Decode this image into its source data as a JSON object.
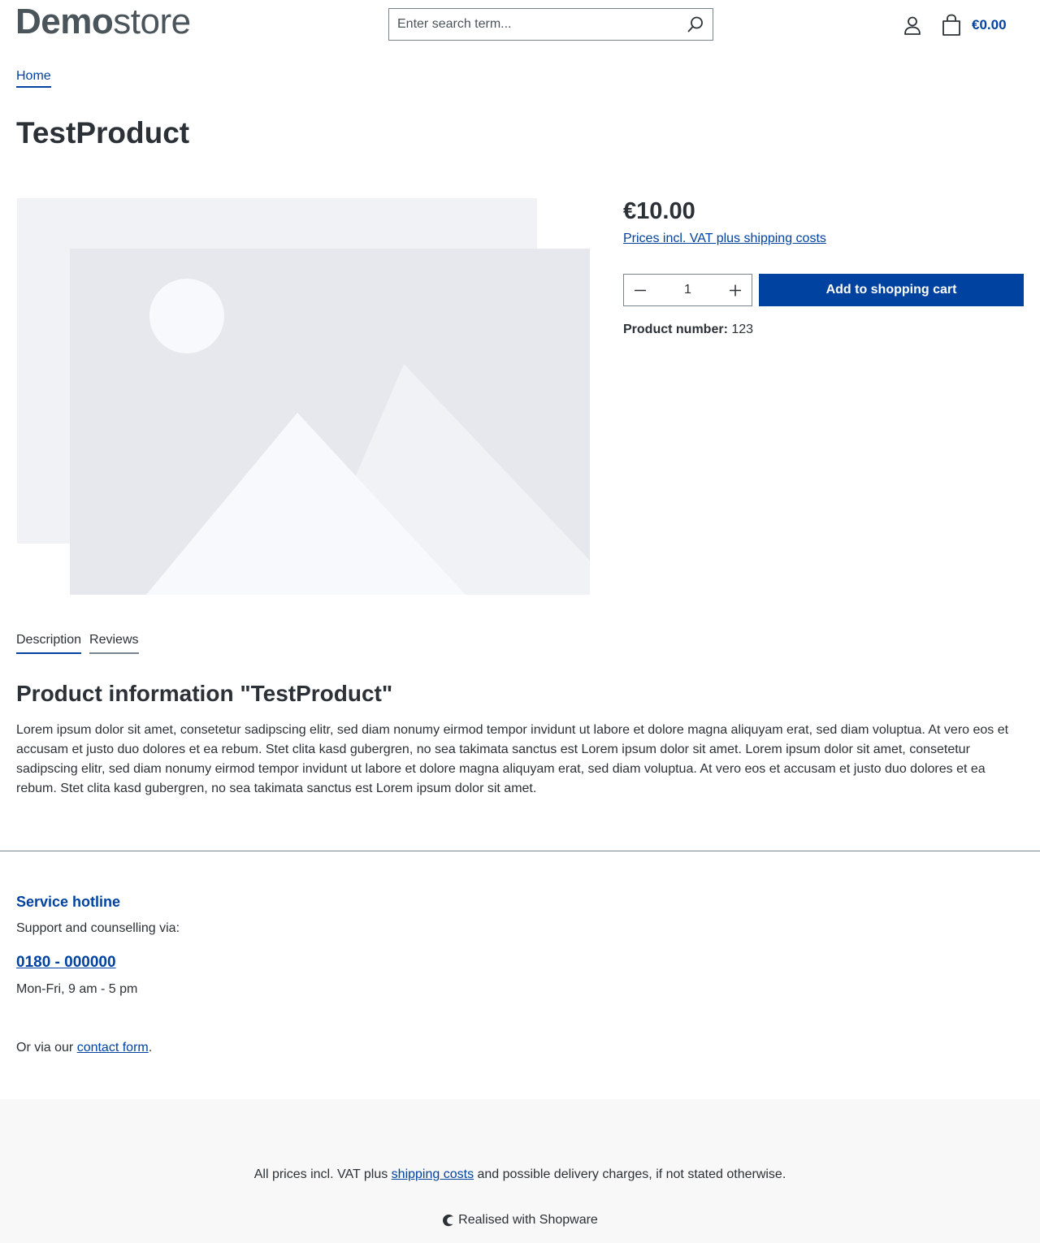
{
  "header": {
    "logo_bold": "Demo",
    "logo_light": "store",
    "search_placeholder": "Enter search term...",
    "cart_total": "€0.00"
  },
  "breadcrumb": {
    "home": "Home"
  },
  "product": {
    "title": "TestProduct",
    "price": "€10.00",
    "tax_link": "Prices incl. VAT plus shipping costs",
    "quantity": "1",
    "add_to_cart": "Add to shopping cart",
    "number_label": "Product number:",
    "number_value": "123"
  },
  "tabs": [
    {
      "label": "Description",
      "active": true
    },
    {
      "label": "Reviews",
      "active": false
    }
  ],
  "description": {
    "title": "Product information \"TestProduct\"",
    "text": "Lorem ipsum dolor sit amet, consetetur sadipscing elitr, sed diam nonumy eirmod tempor invidunt ut labore et dolore magna aliquyam erat, sed diam voluptua. At vero eos et accusam et justo duo dolores et ea rebum. Stet clita kasd gubergren, no sea takimata sanctus est Lorem ipsum dolor sit amet. Lorem ipsum dolor sit amet, consetetur sadipscing elitr, sed diam nonumy eirmod tempor invidunt ut labore et dolore magna aliquyam erat, sed diam voluptua. At vero eos et accusam et justo duo dolores et ea rebum. Stet clita kasd gubergren, no sea takimata sanctus est Lorem ipsum dolor sit amet."
  },
  "footer": {
    "hotline_title": "Service hotline",
    "hotline_sub": "Support and counselling via:",
    "hotline_phone": "0180 - 000000",
    "hotline_hours": "Mon-Fri, 9 am - 5 pm",
    "contact_prefix": "Or via our ",
    "contact_link": "contact form",
    "contact_suffix": ".",
    "vat_prefix": "All prices incl. VAT plus ",
    "vat_link": "shipping costs",
    "vat_suffix": " and possible delivery charges, if not stated otherwise.",
    "realised": "Realised with Shopware"
  },
  "colors": {
    "brand": "#0042a0",
    "text": "#2b3136",
    "placeholder_light": "#f0f2f6",
    "placeholder_dark": "#e6e8ed"
  },
  "icons": {
    "search": "search-icon",
    "account": "account-icon",
    "cart": "cart-icon",
    "minus": "minus-icon",
    "plus": "plus-icon",
    "shopware": "shopware-logo-icon"
  }
}
